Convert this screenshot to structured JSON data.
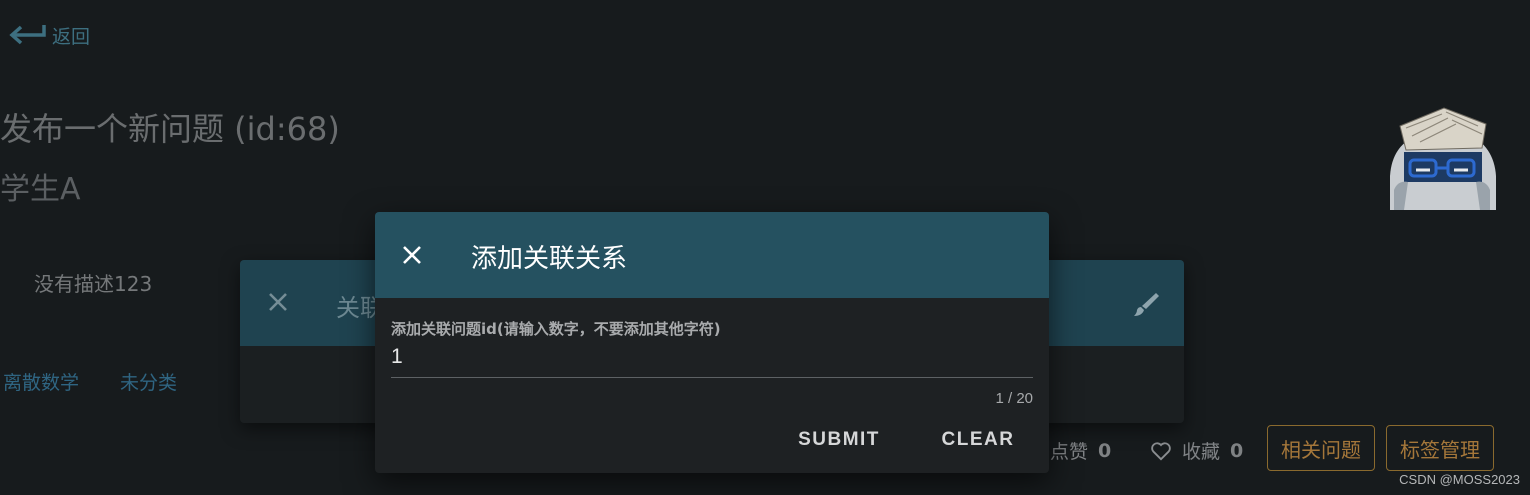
{
  "page": {
    "back_label": "返回",
    "title": "发布一个新问题 (id:68)",
    "author": "学生A",
    "description": "没有描述123",
    "tags": [
      "离散数学",
      "未分类"
    ],
    "likes_label": "点赞",
    "likes_count": "0",
    "favorites_label": "收藏",
    "favorites_count": "0",
    "related_button": "相关问题",
    "tag_manage_button": "标签管理"
  },
  "underlying_dialog": {
    "title_visible": "关联"
  },
  "dialog": {
    "title": "添加关联关系",
    "field_label": "添加关联问题id(请输入数字，不要添加其他字符)",
    "field_value": "1",
    "counter": "1 / 20",
    "submit_label": "SUBMIT",
    "clear_label": "CLEAR"
  },
  "watermark": "CSDN @MOSS2023",
  "icons": {
    "back": "arrow-left-return-icon",
    "close": "close-icon",
    "brush": "brush-icon",
    "heart": "heart-outline-icon"
  },
  "colors": {
    "dialog_header": "#255160",
    "background": "#171b1d",
    "accent_link": "#3d6f80",
    "outline_button": "#a5773a"
  }
}
